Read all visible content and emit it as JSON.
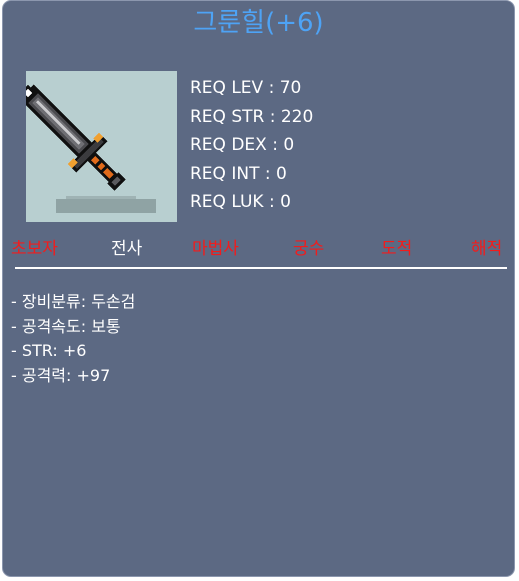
{
  "item": {
    "name": "그룬힐(+6)"
  },
  "requirements": [
    "REQ LEV : 70",
    "REQ STR : 220",
    "REQ DEX : 0",
    "REQ INT : 0",
    "REQ LUK : 0"
  ],
  "jobs": [
    {
      "label": "초보자",
      "equippable": false
    },
    {
      "label": "전사",
      "equippable": true
    },
    {
      "label": "마법사",
      "equippable": false
    },
    {
      "label": "궁수",
      "equippable": false
    },
    {
      "label": "도적",
      "equippable": false
    },
    {
      "label": "해적",
      "equippable": false
    }
  ],
  "stats": [
    "- 장비분류: 두손검",
    "- 공격속도: 보통",
    "- STR: +6",
    "- 공격력: +97"
  ],
  "colors": {
    "panel": "#5c6983",
    "title": "#4ea3f5",
    "job_enabled": "#ffffff",
    "job_disabled": "#f21c1c",
    "icon_background": "#b8cfd0"
  },
  "icons": {
    "item": "two-handed-sword-icon"
  }
}
